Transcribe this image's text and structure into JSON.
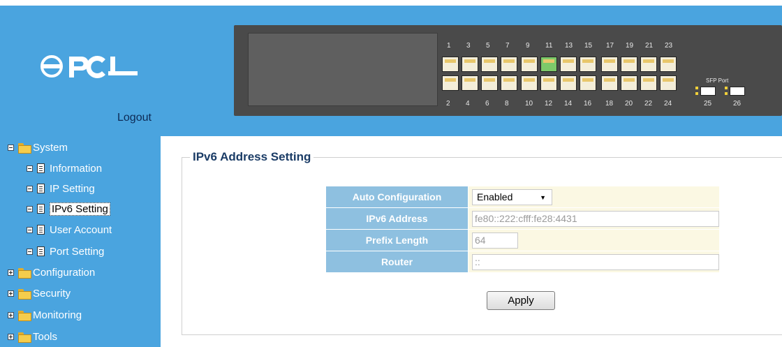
{
  "header": {
    "logo_icon": "pci-logo-icon",
    "logout_label": "Logout"
  },
  "switch_panel": {
    "top_port_numbers": [
      "1",
      "3",
      "5",
      "7",
      "9",
      "11",
      "13",
      "15",
      "17",
      "19",
      "21",
      "23"
    ],
    "bottom_port_numbers": [
      "2",
      "4",
      "6",
      "8",
      "10",
      "12",
      "14",
      "16",
      "18",
      "20",
      "22",
      "24"
    ],
    "sfp_label": "SFP Port",
    "sfp_port_numbers": [
      "25",
      "26"
    ],
    "active_port": "11"
  },
  "sidebar": {
    "items": [
      {
        "label": "System",
        "toggle": "minus",
        "icon": "folder-open-icon"
      },
      {
        "label": "Information",
        "toggle": "minus",
        "icon": "document-icon"
      },
      {
        "label": "IP Setting",
        "toggle": "minus",
        "icon": "document-icon"
      },
      {
        "label": "IPv6 Setting",
        "toggle": "minus",
        "icon": "document-icon",
        "selected": true
      },
      {
        "label": "User Account",
        "toggle": "minus",
        "icon": "document-icon"
      },
      {
        "label": "Port Setting",
        "toggle": "minus",
        "icon": "document-icon"
      },
      {
        "label": "Configuration",
        "toggle": "plus",
        "icon": "folder-icon"
      },
      {
        "label": "Security",
        "toggle": "plus",
        "icon": "folder-icon"
      },
      {
        "label": "Monitoring",
        "toggle": "plus",
        "icon": "folder-icon"
      },
      {
        "label": "Tools",
        "toggle": "plus",
        "icon": "folder-icon"
      }
    ]
  },
  "main": {
    "section_title": "IPv6 Address Setting",
    "fields": {
      "auto_config": {
        "label": "Auto Configuration",
        "value": "Enabled"
      },
      "ipv6_address": {
        "label": "IPv6 Address",
        "value": "fe80::222:cfff:fe28:4431"
      },
      "prefix_length": {
        "label": "Prefix Length",
        "value": "64"
      },
      "router": {
        "label": "Router",
        "value": "::"
      }
    },
    "apply_label": "Apply"
  },
  "colors": {
    "band_blue": "#4aa4df",
    "label_cell_blue": "#8ec0e0",
    "value_cell_cream": "#fbf8e3",
    "title_navy": "#1b3c66"
  }
}
